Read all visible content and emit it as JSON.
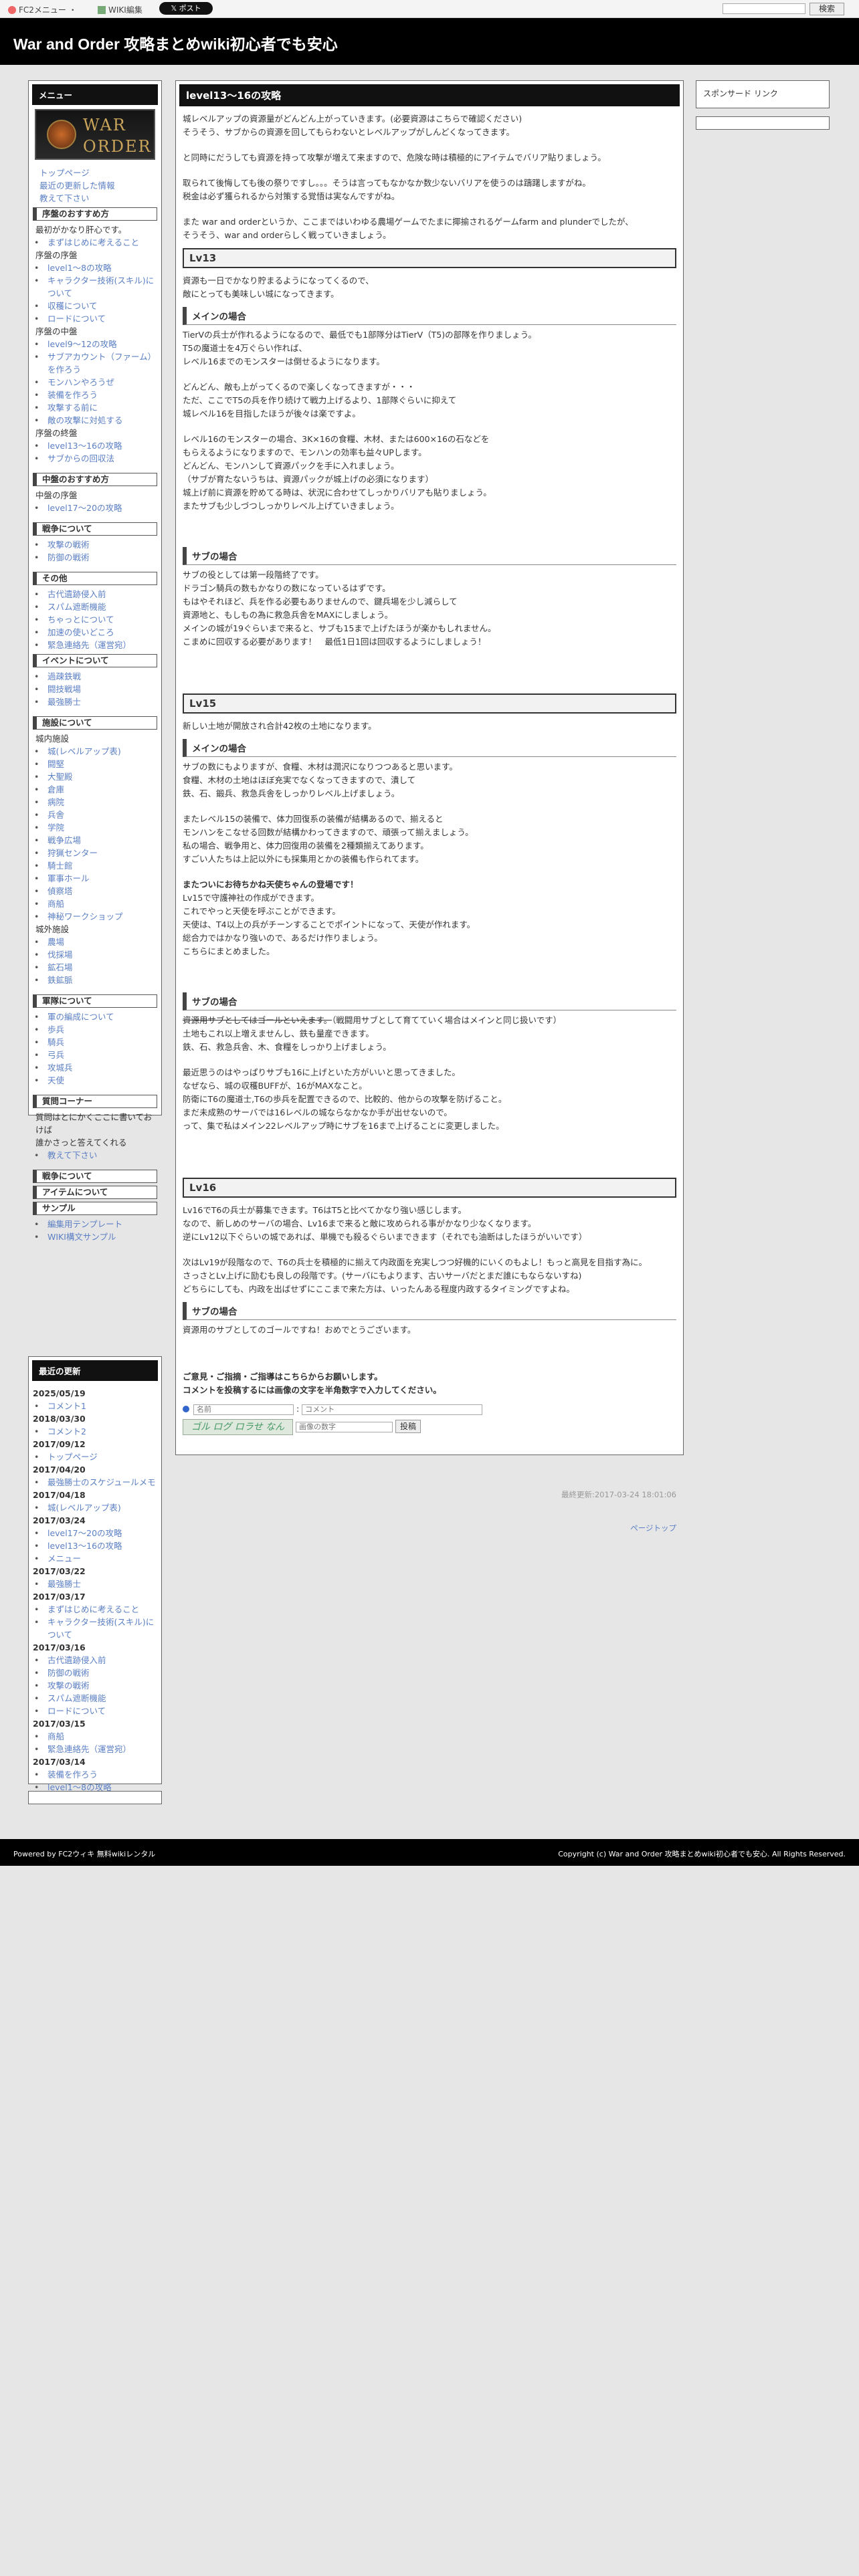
{
  "topbar": {
    "fc2_menu": "FC2メニュー ・",
    "wiki_edit": "WIKI編集",
    "post": "𝕏 ポスト",
    "search_btn": "検索"
  },
  "site_title": "War and Order 攻略まとめwiki初心者でも安心",
  "sidebar": {
    "menu_title": "メニュー",
    "logo_line1": "WAR",
    "logo_line2": "ORDER",
    "top_links": [
      "トップページ",
      "最近の更新した情報",
      "教えて下さい"
    ],
    "sec1": "序盤のおすすめ方",
    "s1_text": "最初がかなり肝心です。",
    "s1_items": [
      "まずはじめに考えること"
    ],
    "s1_sub": "序盤の序盤",
    "s1_sub_items": [
      "level1～8の攻略",
      "キャラクター技術(スキル)について",
      "収穫について",
      "ロードについて"
    ],
    "s1_sub2": "序盤の中盤",
    "s1_sub2_items": [
      "level9～12の攻略",
      "サブアカウント（ファーム）を作ろう",
      "モンハンやろうぜ",
      "装備を作ろう",
      "攻撃する前に",
      "敵の攻撃に対処する"
    ],
    "s1_sub3": "序盤の終盤",
    "s1_sub3_items": [
      "level13～16の攻略",
      "サブからの回収法"
    ],
    "sec2": "中盤のおすすめ方",
    "s2_sub": "中盤の序盤",
    "s2_items": [
      "level17～20の攻略"
    ],
    "sec3": "戦争について",
    "s3_items": [
      "攻撃の戦術",
      "防御の戦術"
    ],
    "sec4": "その他",
    "s4_items": [
      "古代遺跡侵入前",
      "スパム遮断機能",
      "ちゃっとについて",
      "加速の使いどころ",
      "緊急連絡先（運営宛）"
    ],
    "sec5": "イベントについて",
    "s5_items": [
      "過疎鉄戦",
      "闘技戦場",
      "最強勝士"
    ],
    "sec6": "施設について",
    "s6_sub": "城内施設",
    "s6_items": [
      "城(レベルアップ表)",
      "闘堅",
      "大聖殿",
      "倉庫",
      "病院",
      "兵舎",
      "学院",
      "戦争広場",
      "狩猟センター",
      "騎士館",
      "軍事ホール",
      "偵察塔",
      "商船",
      "神秘ワークショップ"
    ],
    "s6_sub2": "城外施設",
    "s6_items2": [
      "農場",
      "伐採場",
      "鉱石場",
      "鉄鉱脈"
    ],
    "sec7": "軍隊について",
    "s7_items": [
      "軍の編成について",
      "歩兵",
      "騎兵",
      "弓兵",
      "攻城兵",
      "天使"
    ],
    "sec8": "質問コーナー",
    "s8_text": "質問はとにかくここに書いておけば",
    "s8_text2": "誰かさっと答えてくれる",
    "s8_items": [
      "教えて下さい"
    ],
    "sec9": "戦争について",
    "sec10": "アイテムについて",
    "sec11": "サンプル",
    "s11_items": [
      "編集用テンプレート",
      "WIKI構文サンプル"
    ]
  },
  "recent": {
    "title": "最近の更新",
    "entries": [
      {
        "date": "2025/05/19",
        "items": [
          "コメント1"
        ]
      },
      {
        "date": "2018/03/30",
        "items": [
          "コメント2"
        ]
      },
      {
        "date": "2017/09/12",
        "items": [
          "トップページ"
        ]
      },
      {
        "date": "2017/04/20",
        "items": [
          "最強勝士のスケジュールメモ"
        ]
      },
      {
        "date": "2017/04/18",
        "items": [
          "城(レベルアップ表)"
        ]
      },
      {
        "date": "2017/03/24",
        "items": [
          "level17～20の攻略",
          "level13～16の攻略",
          "メニュー"
        ]
      },
      {
        "date": "2017/03/22",
        "items": [
          "最強勝士"
        ]
      },
      {
        "date": "2017/03/17",
        "items": [
          "まずはじめに考えること",
          "キャラクター技術(スキル)について"
        ]
      },
      {
        "date": "2017/03/16",
        "items": [
          "古代遺跡侵入前",
          "防御の戦術",
          "攻撃の戦術",
          "スパム遮断機能",
          "ロードについて"
        ]
      },
      {
        "date": "2017/03/15",
        "items": [
          "商船",
          "緊急連絡先（運営宛）"
        ]
      },
      {
        "date": "2017/03/14",
        "items": [
          "装備を作ろう",
          "level1～8の攻略"
        ]
      }
    ]
  },
  "right": {
    "sponsor": "スポンサード リンク"
  },
  "main": {
    "title": "level13～16の攻略",
    "intro": [
      "城レベルアップの資源量がどんどん上がっていきます。(必要資源はこちらで確認ください)",
      "そうそう、サブからの資源を回してもらわないとレベルアップがしんどくなってきます。",
      "",
      "と同時にだうしても資源を持って攻撃が増えて来ますので、危険な時は積極的にアイテムでバリア貼りましょう。",
      "",
      "取られて後悔しても後の祭りですし。。。そうは言ってもなかなか数少ないバリアを使うのは躊躇しますがね。",
      "税金は必ず獲られるから対策する覚悟は実なんですがね。",
      "",
      "また war and orderというか、ここまではいわゆる農場ゲームでたまに揶揄されるゲームfarm and plunderでしたが、",
      "そうそう、war and orderらしく戦っていきましょう。"
    ],
    "lv13": "Lv13",
    "lv13_text": [
      "資源も一日でかなり貯まるようになってくるので、",
      "敵にとっても美味しい城になってきます。"
    ],
    "main_case": "メインの場合",
    "m13": [
      "TierVの兵士が作れるようになるので、最低でも1部隊分はTierV（T5)の部隊を作りましょう。",
      "T5の魔道士を4万ぐらい作れば、",
      "レベル16までのモンスターは倒せるようになります。",
      "",
      "どんどん、敵も上がってくるので楽しくなってきますが・・・",
      "ただ、ここでT5の兵を作り続けて戦力上げるより、1部隊ぐらいに抑えて",
      "城レベル16を目指したほうが後々は楽ですよ。",
      "",
      "レベル16のモンスターの場合、3K×16の食糧、木材、または600×16の石などを",
      "もらえるようになりますので、モンハンの効率も益々UPします。",
      "どんどん、モンハンして資源パックを手に入れましょう。",
      "（サブが育たないうちは、資源パックが城上げの必須になります）",
      "城上げ前に資源を貯めてる時は、状況に合わせてしっかりバリアも貼りましょう。",
      "またサブも少しづつしっかりレベル上げていきましょう。"
    ],
    "sub_case": "サブの場合",
    "s13": [
      "サブの役としては第一段階終了です。",
      "ドラゴン騎兵の数もかなりの数になっているはずです。",
      "もはやそれほど、兵を作る必要もありませんので、鍵兵場を少し減らして",
      "資源地と、もしもの為に救急兵舎をMAXにしましょう。",
      "メインの城が19ぐらいまで来ると、サブも15まで上げたほうが楽かもしれません。",
      "こまめに回収する必要があります！　最低1日1回は回収するようにしましょう！"
    ],
    "lv15": "Lv15",
    "lv15_text": [
      "新しい土地が開放され合計42枚の土地になります。"
    ],
    "m15": [
      "サブの数にもよりますが、食糧、木材は潤沢になりつつあると思います。",
      "食糧、木材の土地はほぼ充実でなくなってきますので、潰して",
      "鉄、石、鍛兵、救急兵舎をしっかりレベル上げましょう。",
      "",
      "またレベル15の装備で、体力回復系の装備が結構あるので、揃えると",
      "モンハンをこなせる回数が結構かわってきますので、頑張って揃えましょう。",
      "私の場合、戦争用と、体力回復用の装備を2種類揃えてあります。",
      "すごい人たちは上記以外にも採集用とかの装備も作られてます。"
    ],
    "m15_bold": "またついにお待ちかね天使ちゃんの登場です！",
    "m15b": [
      "Lv15で守護神社の作成ができます。",
      "これでやっと天使を呼ぶことができます。",
      "天使は、T4以上の兵がチーンすることでポイントになって、天使が作れます。",
      "総合力ではかなり強いので、あるだけ作りましょう。",
      "こちらにまとめました。"
    ],
    "s15_strike": "資源用サブとしてはゴールといえます。",
    "s15_after": "（戦闘用サブとして育てていく場合はメインと同じ扱いです）",
    "s15": [
      "土地もこれ以上増えませんし、鉄も量産できます。",
      "鉄、石、救急兵舎、木、食糧をしっかり上げましょう。",
      "",
      "最近思うのはやっぱりサブも16に上げといた方がいいと思ってきました。",
      "なぜなら、城の収穫BUFFが、16がMAXなこと。",
      "防衛にT6の魔道士,T6の歩兵を配置できるので、比較的、他からの攻撃を防げること。",
      "まだ未成熟のサーバでは16レベルの城ならなかなか手が出せないので。",
      "って、集で私はメイン22レベルアップ時にサブを16まで上げることに変更しました。"
    ],
    "lv16": "Lv16",
    "lv16_text": [
      "Lv16でT6の兵士が募集できます。T6はT5と比べてかなり強い感じします。",
      "なので、新しめのサーバの場合、Lv16まで来ると敵に攻められる事がかなり少なくなります。",
      "逆にLv12以下ぐらいの城であれば、単機でも殺るぐらいまできます（それでも油断はしたほうがいいです）",
      "",
      "次はLv19が段階なので、T6の兵士を積極的に揃えて内政面を充実しつつ好機的にいくのもよし！もっと高見を目指す為に。",
      "さっさとLv上げに励むも良しの段階です。(サーバにもよります、古いサーバだとまだ誰にもならないすね)",
      "どちらにしても、内政を出ばせずにここまで来た方は、いったんある程度内政するタイミングですよね。"
    ],
    "s16": [
      "資源用のサブとしてのゴールですね！おめでとうございます。"
    ],
    "comment_head1": "ご意見・ご指摘・ご指導はこちらからお願いします。",
    "comment_head2": "コメントを投稿するには画像の文字を半角数字で入力してください。",
    "name_ph": "名前",
    "comment_ph": "コメント",
    "captcha_ph": "画像の数字",
    "submit": "投稿",
    "captcha_text": "ゴル ログ ロラせ なん",
    "updated": "最終更新:2017-03-24 18:01:06",
    "pagetop": "ページトップ"
  },
  "footer": {
    "left": "Powered by FC2ウィキ 無料wikiレンタル",
    "right": "Copyright (c) War and Order 攻略まとめwiki初心者でも安心. All Rights Reserved."
  }
}
